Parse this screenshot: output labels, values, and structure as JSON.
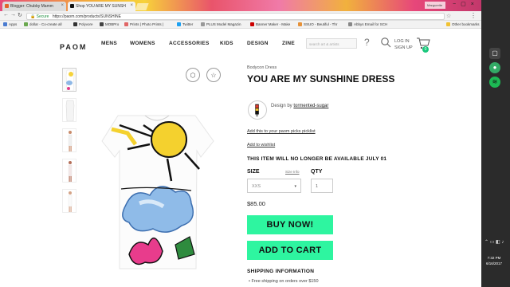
{
  "browser": {
    "tabs": [
      {
        "title": "Blogger: Chubby Mamm",
        "active": false
      },
      {
        "title": "Shop YOU ARE MY SUNSH",
        "active": true
      }
    ],
    "user_label": "Marguerite",
    "secure_label": "Secure",
    "url": "https://paom.com/products/SUNSHINE",
    "bookmarks": [
      {
        "label": "Apps",
        "color": "#4a7bd0"
      },
      {
        "label": "dollar - Co-create all",
        "color": "#6aa84f"
      },
      {
        "label": "Polyvore",
        "color": "#333333"
      },
      {
        "label": "MOBPro",
        "color": "#444444"
      },
      {
        "label": "Prints | Photo Prints |",
        "color": "#e06666"
      },
      {
        "label": "Twitter",
        "color": "#1da1f2"
      },
      {
        "label": "PLUS Model Magazin",
        "color": "#999999"
      },
      {
        "label": "Banner Maker - Make",
        "color": "#cc0000"
      },
      {
        "label": "SSUO - Beutiful - Thr",
        "color": "#e69138"
      },
      {
        "label": "Abbys Email for SCH",
        "color": "#888888"
      },
      {
        "label": "Other bookmarks",
        "color": "#f1c232"
      }
    ]
  },
  "taskbar": {
    "time": "7:32 PM",
    "date": "6/16/2017"
  },
  "site": {
    "logo": "PAOM",
    "nav": [
      "MENS",
      "WOMENS",
      "ACCESSORIES",
      "KIDS",
      "DESIGN",
      "ZINE"
    ],
    "search_placeholder": "search art & artists",
    "login": "LOG IN",
    "signup": "SIGN UP",
    "cart_count": "0"
  },
  "product": {
    "category": "Bodycon Dress",
    "title": "YOU ARE MY SUNSHINE DRESS",
    "designed_by_label": "Design by",
    "designer": "tormented-sugar",
    "picklist_link": "Add this to your paom picks picklist",
    "wishlist_link": "Add to wishlist",
    "notice": "THIS ITEM WILL NO LONGER BE AVAILABLE JULY 01",
    "size_label": "SIZE",
    "size_info": "Size Info",
    "size_value": "XXS",
    "qty_label": "QTY",
    "qty_value": "1",
    "price": "$85.00",
    "buy_now": "BUY NOW!",
    "add_to_cart": "ADD TO CART",
    "shipping_title": "SHIPPING INFORMATION",
    "shipping_line": "Free shipping on orders over $150"
  },
  "colors": {
    "accent": "#2ef5a0",
    "cart_badge": "#18c77b"
  }
}
